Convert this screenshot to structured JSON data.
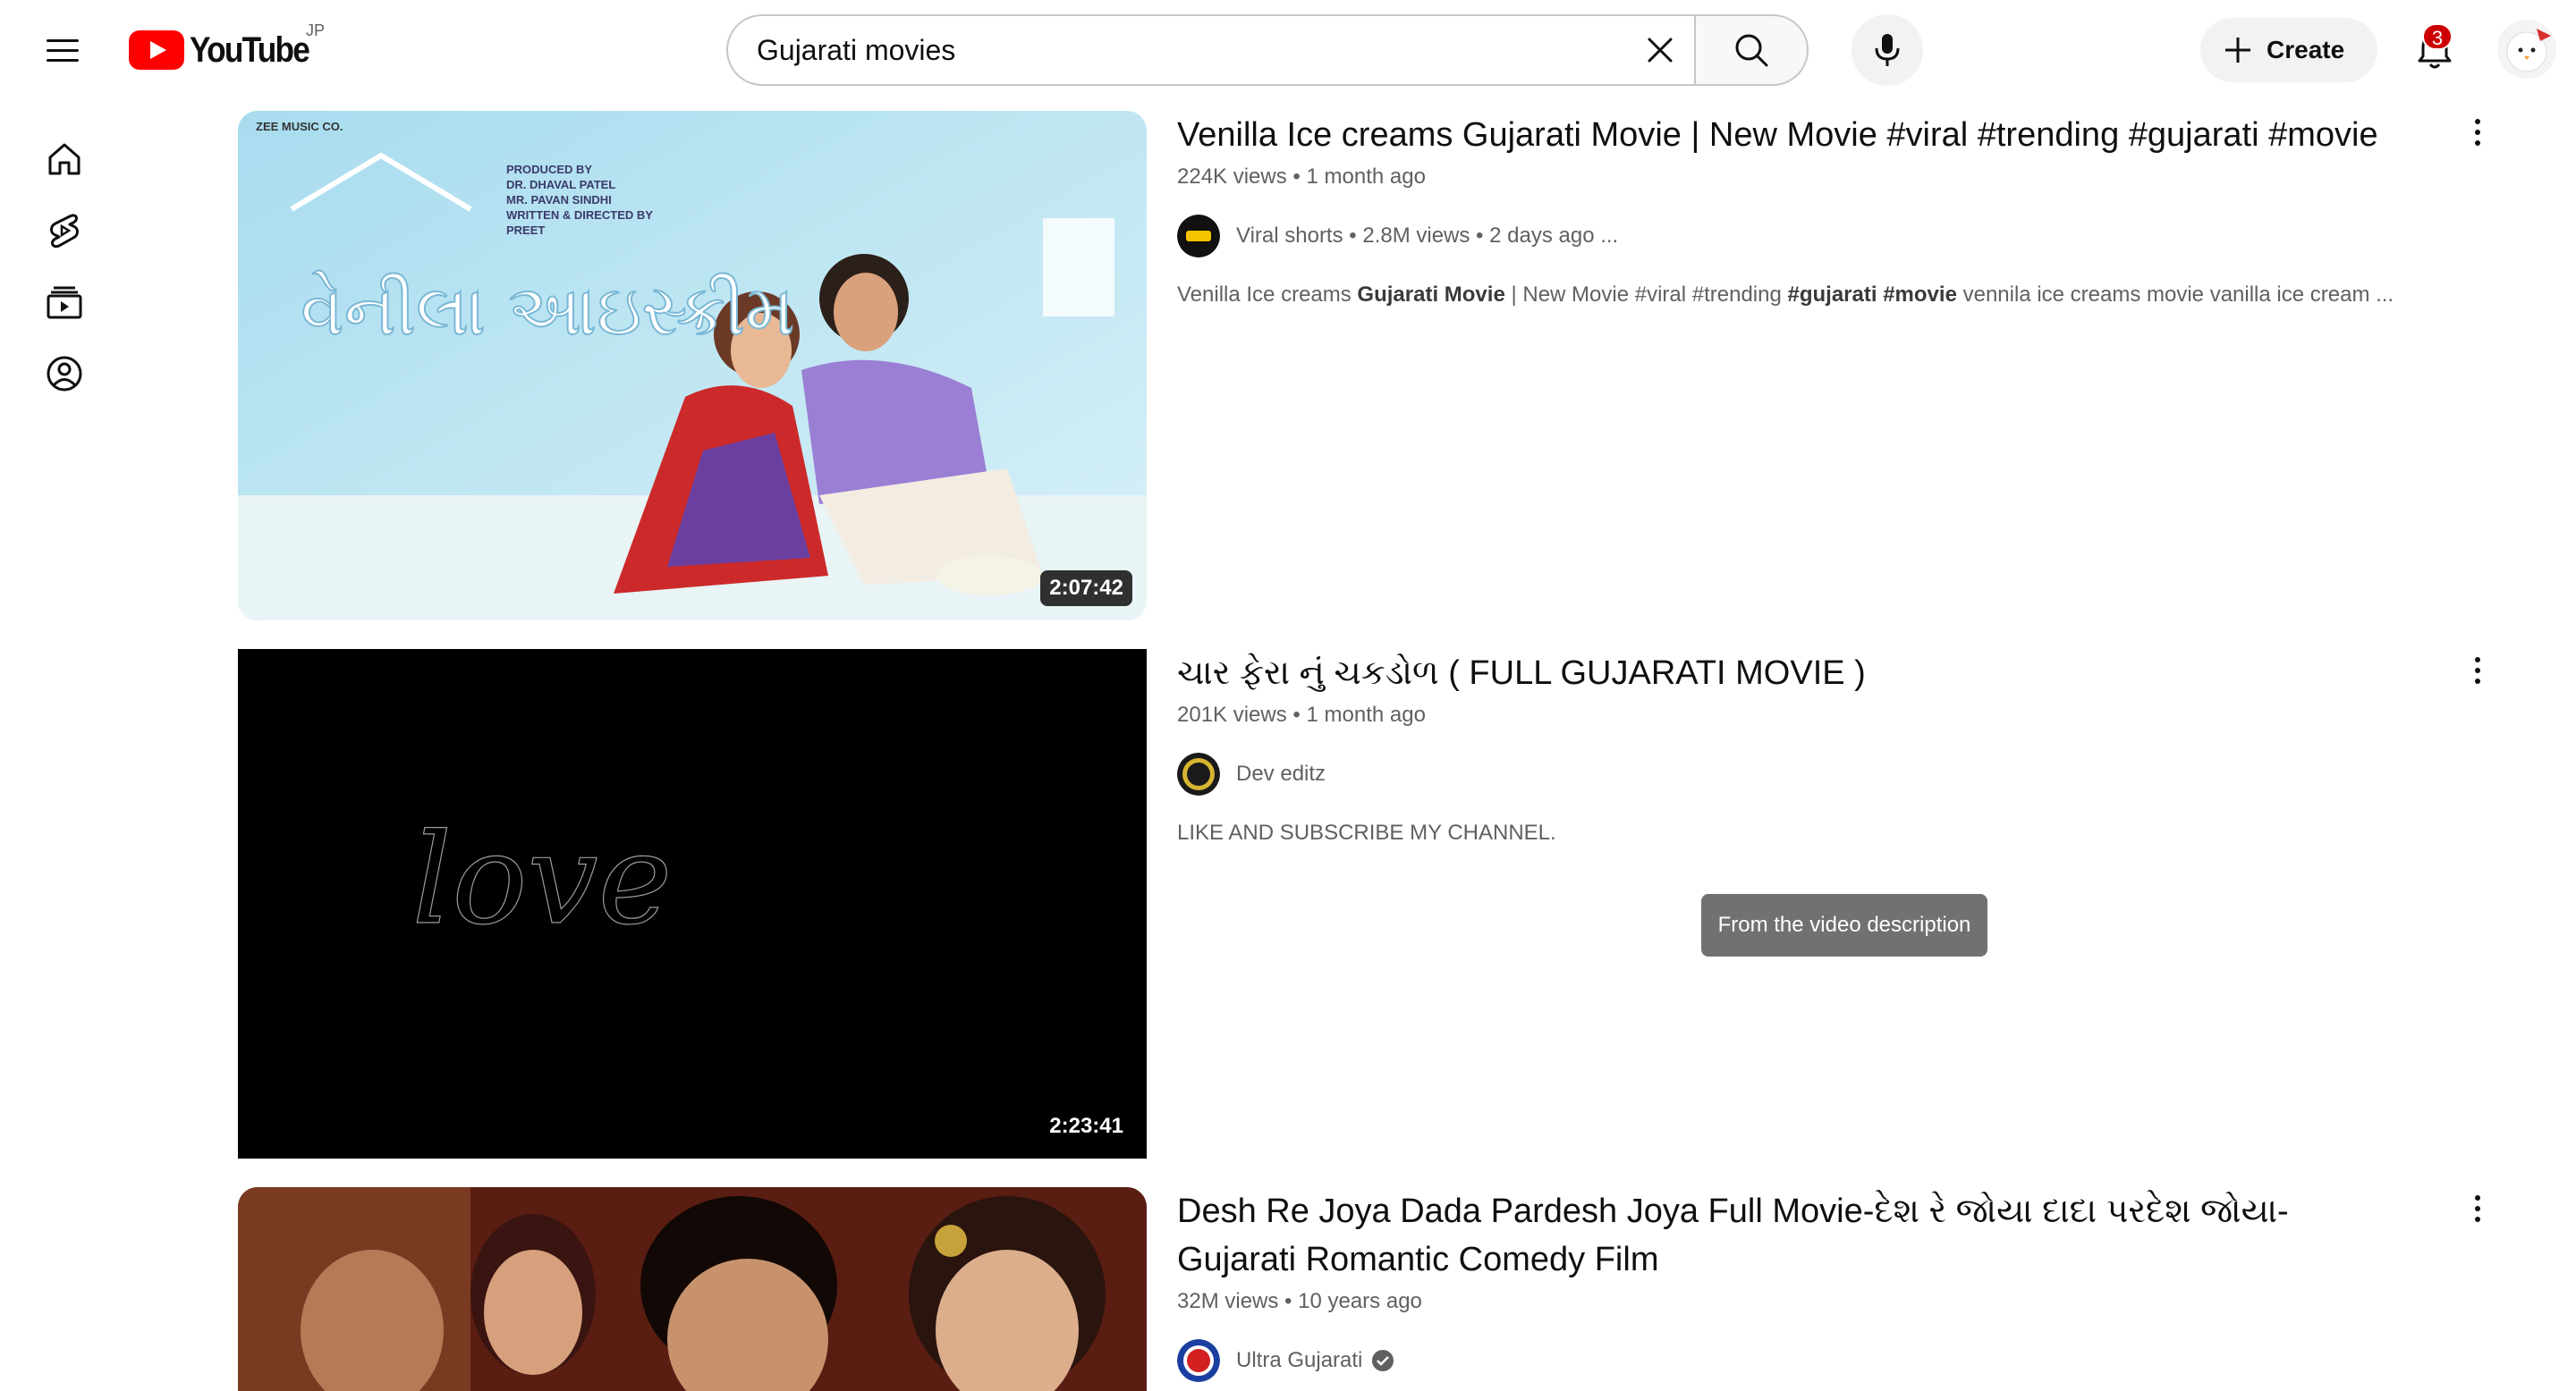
{
  "header": {
    "logo_text": "YouTube",
    "region": "JP",
    "search_value": "Gujarati movies",
    "create_label": "Create",
    "notification_count": "3",
    "icons": [
      "menu-icon",
      "search-icon",
      "clear-icon",
      "mic-icon",
      "plus-icon",
      "bell-icon"
    ]
  },
  "guide": {
    "items": [
      "home-icon",
      "shorts-icon",
      "subscriptions-icon",
      "you-icon"
    ]
  },
  "results": [
    {
      "title": "Venilla Ice creams Gujarati Movie | New Movie #viral #trending #gujarati #movie",
      "views": "224K views",
      "age": "1 month ago",
      "channel": "Viral shorts • 2.8M views • 2 days ago ...",
      "description_parts": [
        "Venilla Ice creams ",
        "Gujarati Movie",
        " | New Movie #viral #trending ",
        "#gujarati",
        " ",
        "#movie",
        " vennila ice creams movie vanilla ice cream ..."
      ],
      "duration": "2:07:42",
      "thumb_text": {
        "brand": "ZEE MUSIC CO.",
        "credits": [
          "PRODUCED BY",
          "DR. DHAVAL PATEL",
          "MR. PAVAN SINDHI",
          "WRITTEN & DIRECTED BY",
          "PREET"
        ],
        "title_art": "વેનીલા આઇસ્ક્રીમ"
      }
    },
    {
      "title": "ચાર ફેરા નું ચકડોળ ( FULL GUJARATI MOVIE )",
      "views": "201K views",
      "age": "1 month ago",
      "channel": "Dev editz",
      "description": "LIKE AND SUBSCRIBE MY CHANNEL.",
      "duration": "2:23:41",
      "thumb_text": "love"
    },
    {
      "title": "Desh Re Joya Dada Pardesh Joya Full Movie-દેશ રે જોયા દાદા પરદેશ જોયા- Gujarati Romantic Comedy Film",
      "views": "32M views",
      "age": "10 years ago",
      "channel": "Ultra Gujarati",
      "verified": true
    }
  ],
  "tooltip": "From the video description",
  "colors": {
    "brand_red": "#ff0000",
    "badge_red": "#cc0000",
    "secondary_text": "#606060"
  }
}
